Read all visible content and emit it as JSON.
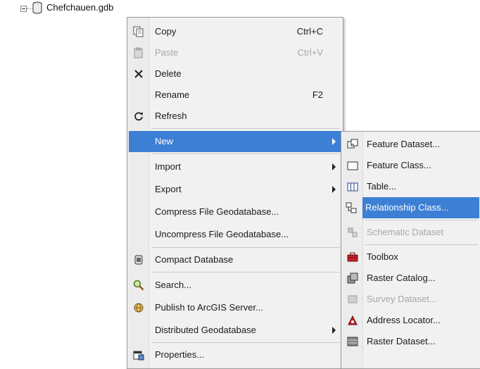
{
  "tree": {
    "label": "Chefchauen.gdb"
  },
  "context_menu": {
    "items": [
      {
        "label": "Copy",
        "shortcut": "Ctrl+C",
        "icon": "copy-icon"
      },
      {
        "label": "Paste",
        "shortcut": "Ctrl+V",
        "icon": "paste-icon",
        "disabled": true
      },
      {
        "label": "Delete",
        "shortcut": "",
        "icon": "delete-icon"
      },
      {
        "label": "Rename",
        "shortcut": "F2",
        "icon": ""
      },
      {
        "label": "Refresh",
        "shortcut": "",
        "icon": "refresh-icon"
      },
      {
        "label": "New",
        "shortcut": "",
        "icon": "",
        "submenu": true,
        "highlighted": true
      },
      {
        "label": "Import",
        "shortcut": "",
        "icon": "",
        "submenu": true
      },
      {
        "label": "Export",
        "shortcut": "",
        "icon": "",
        "submenu": true
      },
      {
        "label": "Compress File Geodatabase...",
        "shortcut": "",
        "icon": ""
      },
      {
        "label": "Uncompress File Geodatabase...",
        "shortcut": "",
        "icon": ""
      },
      {
        "label": "Compact Database",
        "shortcut": "",
        "icon": "compact-database-icon"
      },
      {
        "label": "Search...",
        "shortcut": "",
        "icon": "search-icon"
      },
      {
        "label": "Publish to ArcGIS Server...",
        "shortcut": "",
        "icon": "publish-icon"
      },
      {
        "label": "Distributed Geodatabase",
        "shortcut": "",
        "icon": "",
        "submenu": true
      },
      {
        "label": "Properties...",
        "shortcut": "",
        "icon": "properties-icon"
      }
    ]
  },
  "submenu": {
    "items": [
      {
        "label": "Feature Dataset...",
        "icon": "feature-dataset-icon"
      },
      {
        "label": "Feature Class...",
        "icon": "feature-class-icon"
      },
      {
        "label": "Table...",
        "icon": "table-icon"
      },
      {
        "label": "Relationship Class...",
        "icon": "relationship-class-icon",
        "highlighted": true
      },
      {
        "label": "Schematic Dataset",
        "icon": "schematic-dataset-icon",
        "disabled": true
      },
      {
        "label": "Toolbox",
        "icon": "toolbox-icon"
      },
      {
        "label": "Raster Catalog...",
        "icon": "raster-catalog-icon"
      },
      {
        "label": "Survey Dataset...",
        "icon": "survey-dataset-icon",
        "disabled": true
      },
      {
        "label": "Address Locator...",
        "icon": "address-locator-icon"
      },
      {
        "label": "Raster Dataset...",
        "icon": "raster-dataset-icon"
      }
    ]
  },
  "colors": {
    "highlight": "#3d7fd4",
    "menu_bg": "#f1f1f1",
    "disabled_text": "#a8a8a8"
  }
}
